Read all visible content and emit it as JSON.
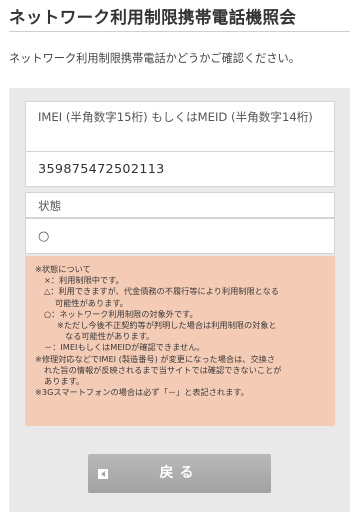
{
  "header": {
    "title": "ネットワーク利用制限携帯電話機照会",
    "subtitle": "ネットワーク利用制限携帯電話かどうかご確認ください。"
  },
  "form": {
    "imei_label": "IMEI (半角数字15桁) もしくはMEID (半角数字14桁)",
    "imei_value": "359875472502113",
    "status_label": "状態",
    "status_value": "○"
  },
  "notes": {
    "lines": [
      "※状態について",
      "×：利用制限中です。",
      "△：利用できますが、代金債務の不履行等により利用制限となる",
      "可能性があります。",
      "○：ネットワーク利用制限の対象外です。",
      "※ただし今後不正契約等が判明した場合は利用制限の対象と",
      "なる可能性があります。",
      "－：IMEIもしくはMEIDが確認できません。",
      "※修理対応などでIMEI (製造番号) が変更になった場合は、交換さ",
      "れた旨の情報が反映されるまで当サイトでは確認できないことが",
      "あります。",
      "※3Gスマートフォンの場合は必ず「－」と表記されます。"
    ]
  },
  "actions": {
    "back_label": "戻る"
  }
}
